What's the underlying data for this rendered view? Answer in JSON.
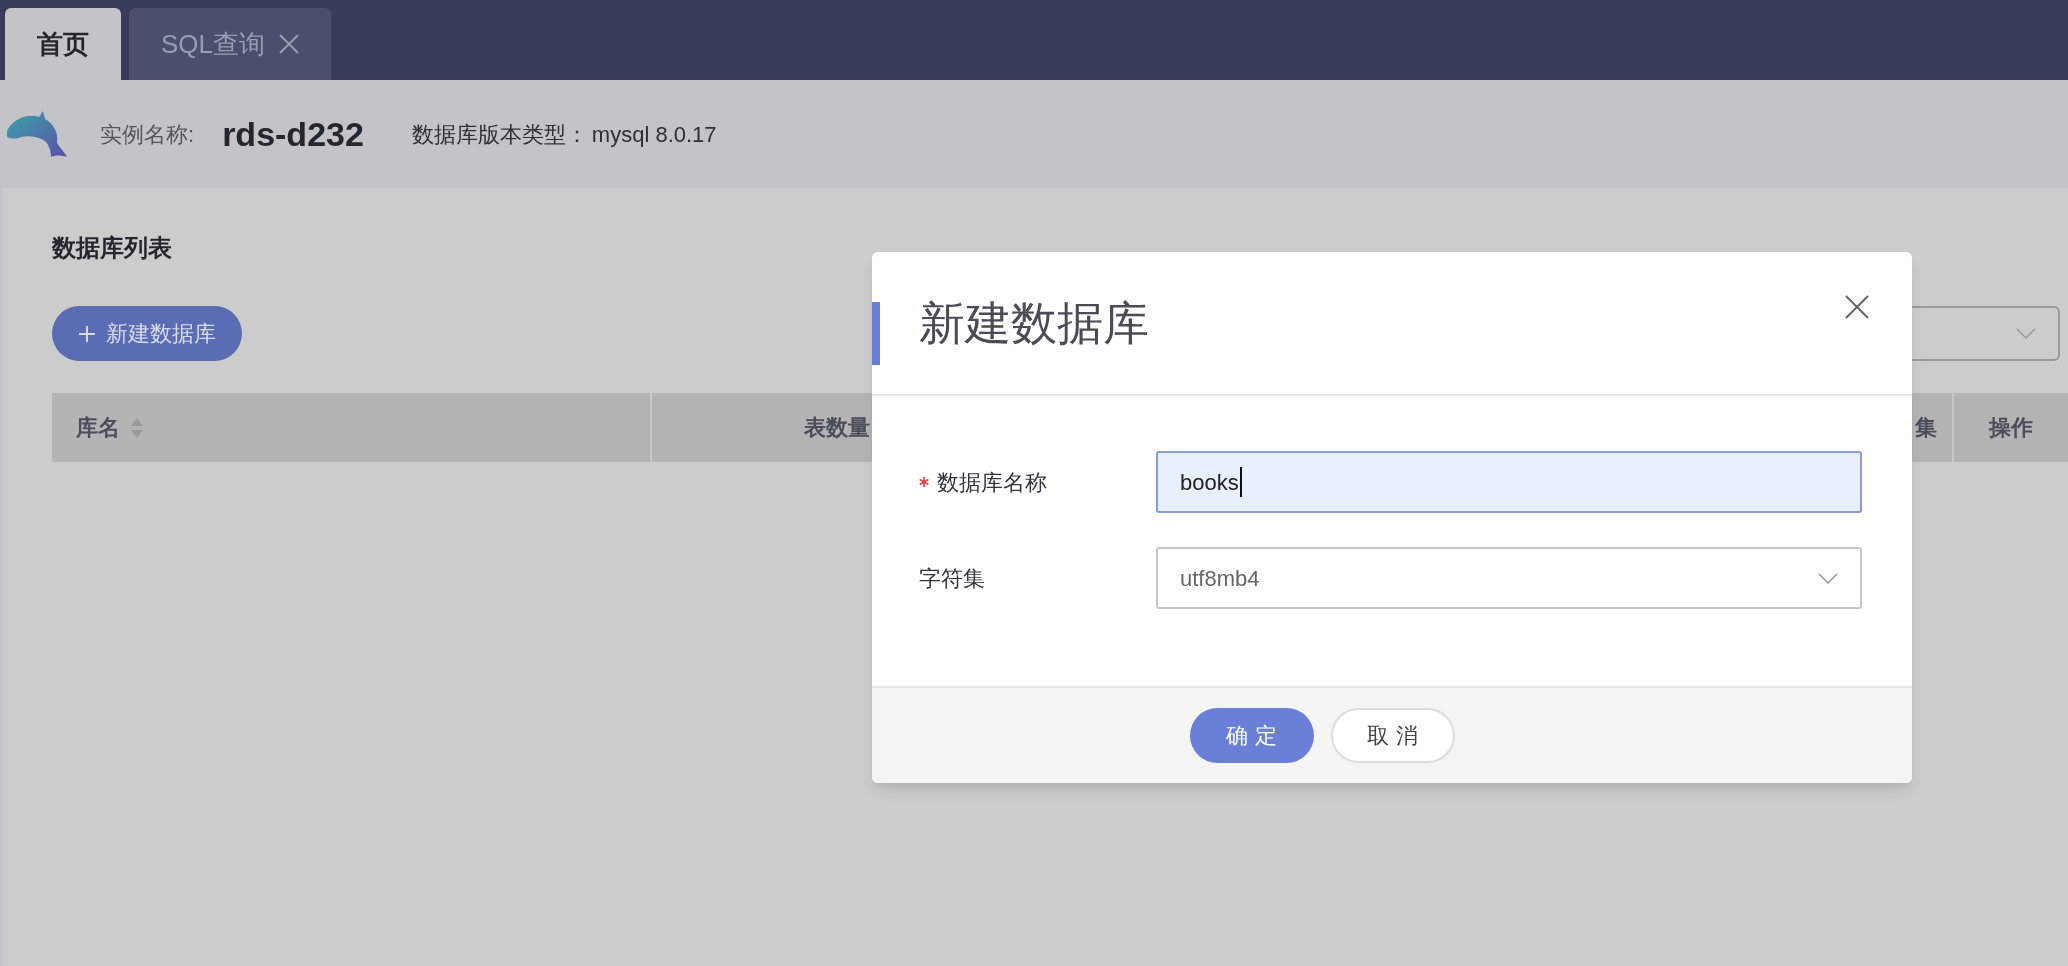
{
  "tabs": [
    {
      "label": "首页",
      "selected": true,
      "closable": false
    },
    {
      "label": "SQL查询",
      "selected": false,
      "closable": true
    }
  ],
  "instance": {
    "name_label": "实例名称:",
    "name": "rds-d232",
    "version_label": "数据库版本类型：",
    "version": "mysql 8.0.17"
  },
  "panel": {
    "title": "数据库列表",
    "new_button": "新建数据库"
  },
  "table": {
    "columns": [
      {
        "label": "库名",
        "sortable": true
      },
      {
        "label": "表数量",
        "sortable": false
      },
      {
        "label": "集",
        "sortable": false
      },
      {
        "label": "操作",
        "sortable": false
      }
    ]
  },
  "dialog": {
    "title": "新建数据库",
    "fields": [
      {
        "kind": "text",
        "label": "数据库名称",
        "required": true,
        "value": "books",
        "focused": true
      },
      {
        "kind": "select",
        "label": "字符集",
        "required": false,
        "value": "utf8mb4",
        "focused": false
      }
    ],
    "buttons": [
      {
        "label": "确 定",
        "primary": true
      },
      {
        "label": "取 消",
        "primary": false
      }
    ]
  }
}
